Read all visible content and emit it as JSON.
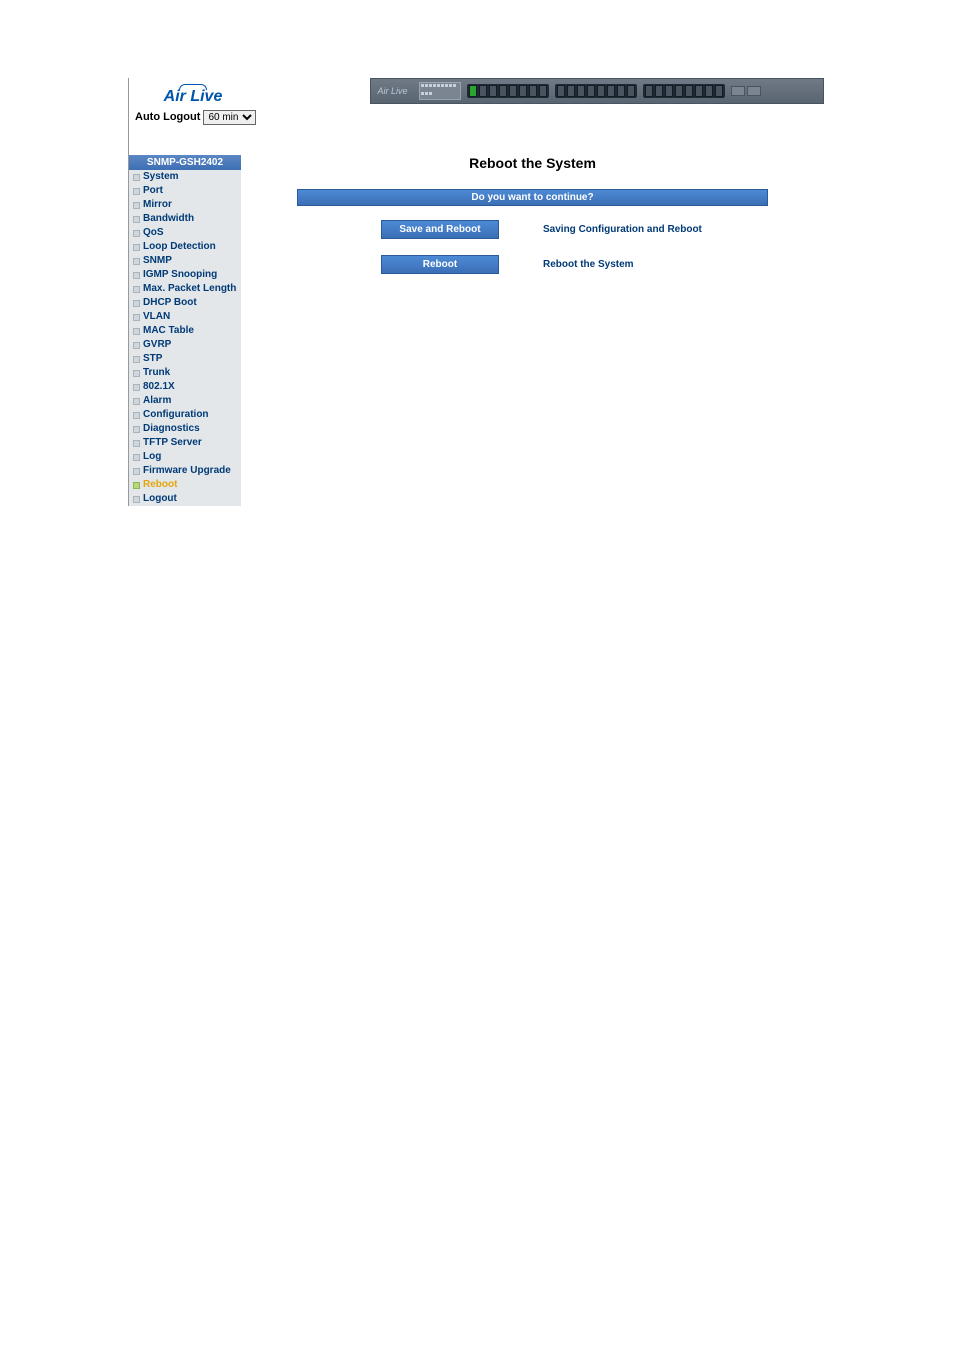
{
  "brand": "Air Live",
  "auto_logout": {
    "label": "Auto Logout",
    "value": "60 min"
  },
  "device_model": "SNMP-GSH2402",
  "nav": {
    "items": [
      {
        "label": "System"
      },
      {
        "label": "Port"
      },
      {
        "label": "Mirror"
      },
      {
        "label": "Bandwidth"
      },
      {
        "label": "QoS"
      },
      {
        "label": "Loop Detection"
      },
      {
        "label": "SNMP"
      },
      {
        "label": "IGMP Snooping"
      },
      {
        "label": "Max. Packet Length"
      },
      {
        "label": "DHCP Boot"
      },
      {
        "label": "VLAN"
      },
      {
        "label": "MAC Table"
      },
      {
        "label": "GVRP"
      },
      {
        "label": "STP"
      },
      {
        "label": "Trunk"
      },
      {
        "label": "802.1X"
      },
      {
        "label": "Alarm"
      },
      {
        "label": "Configuration"
      },
      {
        "label": "Diagnostics"
      },
      {
        "label": "TFTP Server"
      },
      {
        "label": "Log"
      },
      {
        "label": "Firmware Upgrade"
      },
      {
        "label": "Reboot",
        "active": true
      },
      {
        "label": "Logout"
      }
    ]
  },
  "main": {
    "title": "Reboot the System",
    "prompt": "Do you want to continue?",
    "actions": [
      {
        "button": "Save and Reboot",
        "desc": "Saving Configuration and Reboot"
      },
      {
        "button": "Reboot",
        "desc": "Reboot the System"
      }
    ]
  }
}
